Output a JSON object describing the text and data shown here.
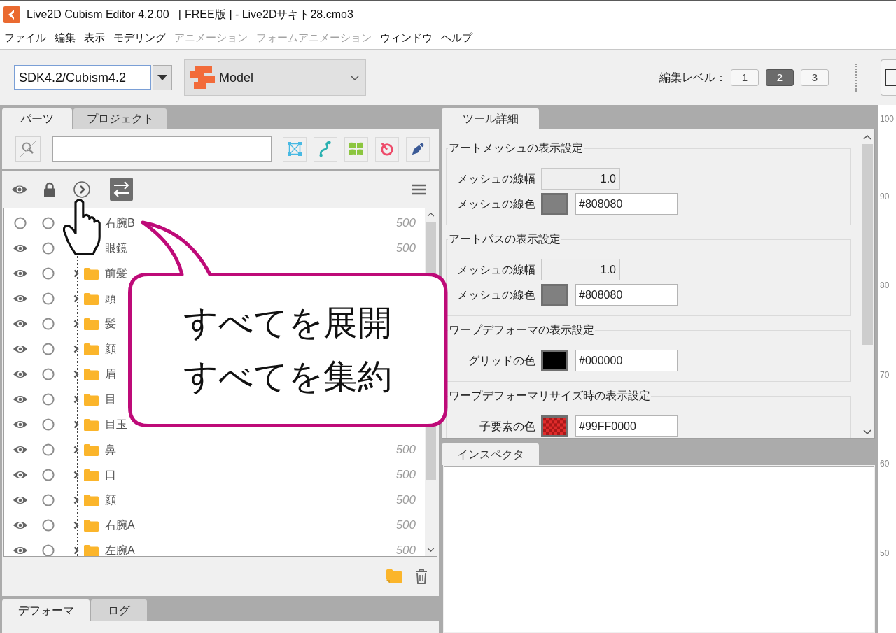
{
  "window": {
    "title": "Live2D Cubism Editor 4.2.00   [ FREE版 ] - Live2Dサキト28.cmo3"
  },
  "menu": [
    {
      "label": "ファイル",
      "disabled": false
    },
    {
      "label": "編集",
      "disabled": false
    },
    {
      "label": "表示",
      "disabled": false
    },
    {
      "label": "モデリング",
      "disabled": false
    },
    {
      "label": "アニメーション",
      "disabled": true
    },
    {
      "label": "フォームアニメーション",
      "disabled": true
    },
    {
      "label": "ウィンドウ",
      "disabled": false
    },
    {
      "label": "ヘルプ",
      "disabled": false
    }
  ],
  "toolbar": {
    "sdk_combo": {
      "value": "SDK4.2/Cubism4.2"
    },
    "mode_dropdown": {
      "value": "Model"
    },
    "edit_level": {
      "label": "編集レベル：",
      "levels": [
        {
          "label": "1",
          "selected": false
        },
        {
          "label": "2",
          "selected": true
        },
        {
          "label": "3",
          "selected": false
        }
      ]
    }
  },
  "parts_panel": {
    "tabs": [
      {
        "label": "パーツ",
        "selected": true
      },
      {
        "label": "プロジェクト",
        "selected": false
      }
    ],
    "rows": [
      {
        "name": "右腕B",
        "visible": false,
        "locked": false,
        "folder": false,
        "order": "500"
      },
      {
        "name": "眼鏡",
        "visible": true,
        "locked": false,
        "folder": false,
        "order": "500"
      },
      {
        "name": "前髪",
        "visible": true,
        "locked": false,
        "folder": true
      },
      {
        "name": "頭",
        "visible": true,
        "locked": false,
        "folder": true
      },
      {
        "name": "髪",
        "visible": true,
        "locked": false,
        "folder": true
      },
      {
        "name": "顔",
        "visible": true,
        "locked": false,
        "folder": true
      },
      {
        "name": "眉",
        "visible": true,
        "locked": false,
        "folder": true
      },
      {
        "name": "目",
        "visible": true,
        "locked": false,
        "folder": true
      },
      {
        "name": "目玉",
        "visible": true,
        "locked": false,
        "folder": true
      },
      {
        "name": "鼻",
        "visible": true,
        "locked": false,
        "folder": true,
        "order": "500"
      },
      {
        "name": "口",
        "visible": true,
        "locked": false,
        "folder": true,
        "order": "500"
      },
      {
        "name": "顔",
        "visible": true,
        "locked": false,
        "folder": true,
        "order": "500"
      },
      {
        "name": "右腕A",
        "visible": true,
        "locked": false,
        "folder": true,
        "order": "500"
      },
      {
        "name": "左腕A",
        "visible": true,
        "locked": false,
        "folder": true,
        "order": "500"
      }
    ]
  },
  "deformer_panel": {
    "tabs": [
      {
        "label": "デフォーマ",
        "selected": true
      },
      {
        "label": "ログ",
        "selected": false
      }
    ]
  },
  "tool_details": {
    "tab": {
      "label": "ツール詳細"
    },
    "sections": [
      {
        "title": "アートメッシュの表示設定",
        "fields": [
          {
            "kind": "number",
            "label": "メッシュの線幅",
            "value": "1.0"
          },
          {
            "kind": "color",
            "label": "メッシュの線色",
            "color": "#808080",
            "value": "#808080"
          }
        ]
      },
      {
        "title": "アートパスの表示設定",
        "fields": [
          {
            "kind": "number",
            "label": "メッシュの線幅",
            "value": "1.0"
          },
          {
            "kind": "color",
            "label": "メッシュの線色",
            "color": "#808080",
            "value": "#808080"
          }
        ]
      },
      {
        "title": "ワープデフォーマの表示設定",
        "fields": [
          {
            "kind": "color",
            "label": "グリッドの色",
            "color": "#000000",
            "value": "#000000"
          }
        ]
      },
      {
        "title": "ワープデフォーマリサイズ時の表示設定",
        "fields": [
          {
            "kind": "color_alpha",
            "label": "子要素の色",
            "color": "#e02b2b",
            "value": "#99FF0000"
          }
        ]
      }
    ]
  },
  "inspector": {
    "tab": {
      "label": "インスペクタ"
    }
  },
  "canvas_ruler": {
    "labels": [
      "100",
      "90",
      "80",
      "70",
      "60",
      "50"
    ]
  },
  "callout": {
    "lines": [
      "すべてを展開",
      "すべてを集約"
    ]
  }
}
